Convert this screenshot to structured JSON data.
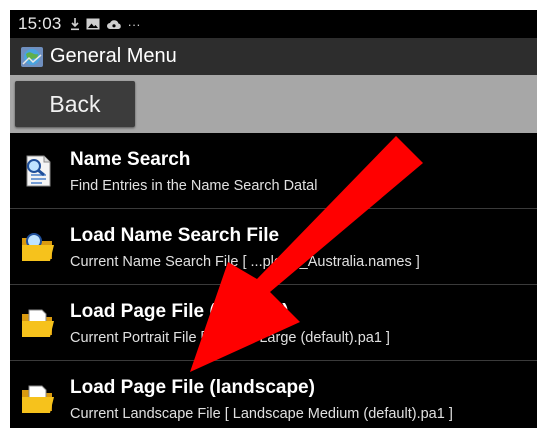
{
  "status_bar": {
    "time": "15:03",
    "icons": [
      "download-icon",
      "image-icon",
      "cloud-icon",
      "more-notifications-icon"
    ],
    "overflow_text": "···"
  },
  "title_bar": {
    "title": "General Menu",
    "icon": "app-globe-icon"
  },
  "toolbar": {
    "back_label": "Back"
  },
  "menu": {
    "items": [
      {
        "title": "Name Search",
        "subtitle": "Find Entries in the Name Search Datal",
        "icon": "name-search-document-icon"
      },
      {
        "title": "Load Name Search File",
        "subtitle": "Current Name Search File [ ...plorer_Australia.names ]",
        "icon": "folder-open-icon"
      },
      {
        "title": "Load Page File (portrait)",
        "subtitle": "Current Portrait File [ Portrait Large (default).pa1 ]",
        "icon": "folder-open-icon"
      },
      {
        "title": "Load Page File (landscape)",
        "subtitle": "Current Landscape File [ Landscape Medium (default).pa1 ]",
        "icon": "folder-open-icon"
      }
    ]
  },
  "overlay": {
    "arrow_color": "#ff0000",
    "arrow_icon": "red-arrow-annotation"
  },
  "colors": {
    "screen_bg": "#000000",
    "title_bar_bg": "#2d2d2d",
    "toolbar_bg": "#a7a7a7",
    "back_button_bg": "#3c3c3c",
    "folder_yellow": "#f6c21c"
  }
}
